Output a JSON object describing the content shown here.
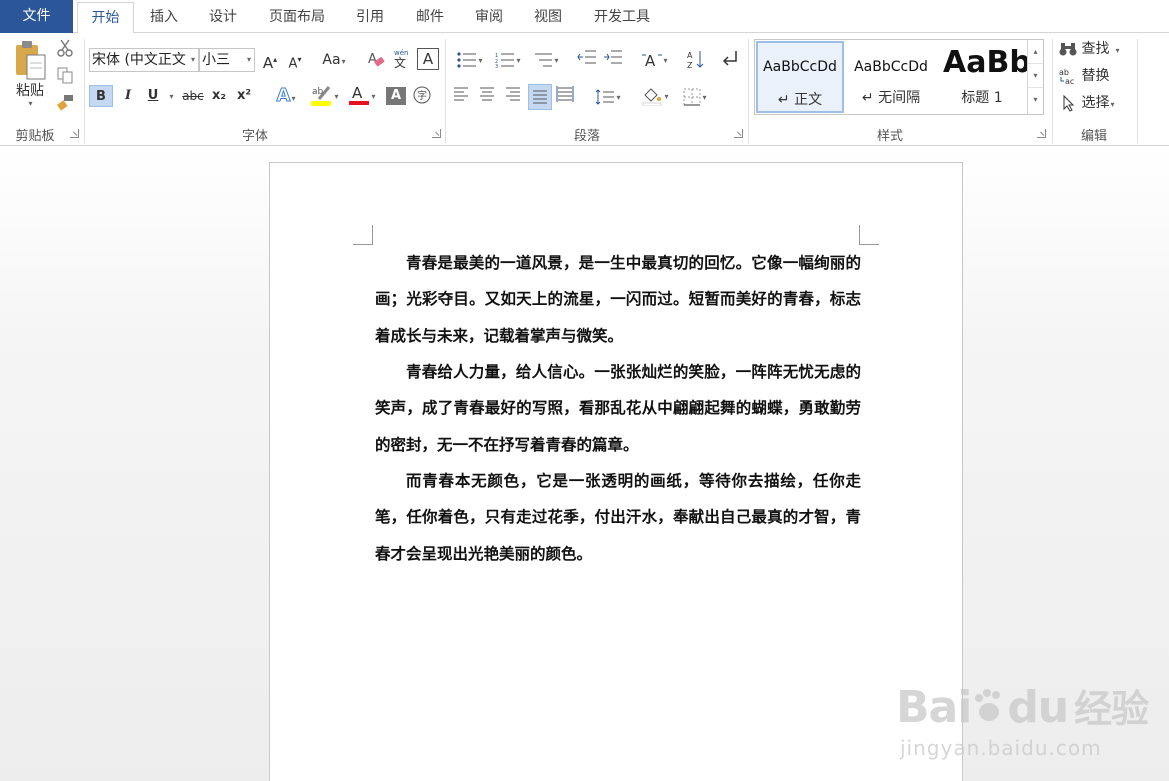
{
  "tabs": [
    {
      "label": "文件"
    },
    {
      "label": "开始"
    },
    {
      "label": "插入"
    },
    {
      "label": "设计"
    },
    {
      "label": "页面布局"
    },
    {
      "label": "引用"
    },
    {
      "label": "邮件"
    },
    {
      "label": "审阅"
    },
    {
      "label": "视图"
    },
    {
      "label": "开发工具"
    }
  ],
  "clipboard": {
    "paste_label": "粘贴",
    "group_label": "剪贴板"
  },
  "font": {
    "group_label": "字体",
    "font_name": "宋体 (中文正文",
    "font_size": "小三",
    "change_case": "Aa",
    "bold": "B",
    "italic": "I",
    "underline": "U",
    "strike": "abc",
    "subscript": "x₂",
    "superscript": "x²",
    "font_color_hex": "#e81123",
    "highlight_hex": "#ffff00"
  },
  "paragraph": {
    "group_label": "段落"
  },
  "styles": {
    "group_label": "样式",
    "items": [
      {
        "sample": "AaBbCcDd",
        "name": "↵ 正文"
      },
      {
        "sample": "AaBbCcDd",
        "name": "↵ 无间隔"
      },
      {
        "sample": "AaBb",
        "name": "标题 1"
      }
    ]
  },
  "editing": {
    "group_label": "编辑",
    "find": "查找",
    "replace": "替换",
    "select": "选择"
  },
  "document": {
    "paragraphs": [
      "青春是最美的一道风景，是一生中最真切的回忆。它像一幅绚丽的画；光彩夺目。又如天上的流星，一闪而过。短暂而美好的青春，标志着成长与未来，记载着掌声与微笑。",
      "青春给人力量，给人信心。一张张灿烂的笑脸，一阵阵无忧无虑的笑声，成了青春最好的写照，看那乱花从中翩翩起舞的蝴蝶，勇敢勤劳的密封，无一不在抒写着青春的篇章。",
      "而青春本无颜色，它是一张透明的画纸，等待你去描绘，任你走笔，任你着色，只有走过花季，付出汗水，奉献出自己最真的才智，青春才会呈现出光艳美丽的颜色。"
    ]
  },
  "watermark": {
    "brand": "Bai",
    "brand2": "du",
    "cn": "经验",
    "url": "jingyan.baidu.com"
  }
}
